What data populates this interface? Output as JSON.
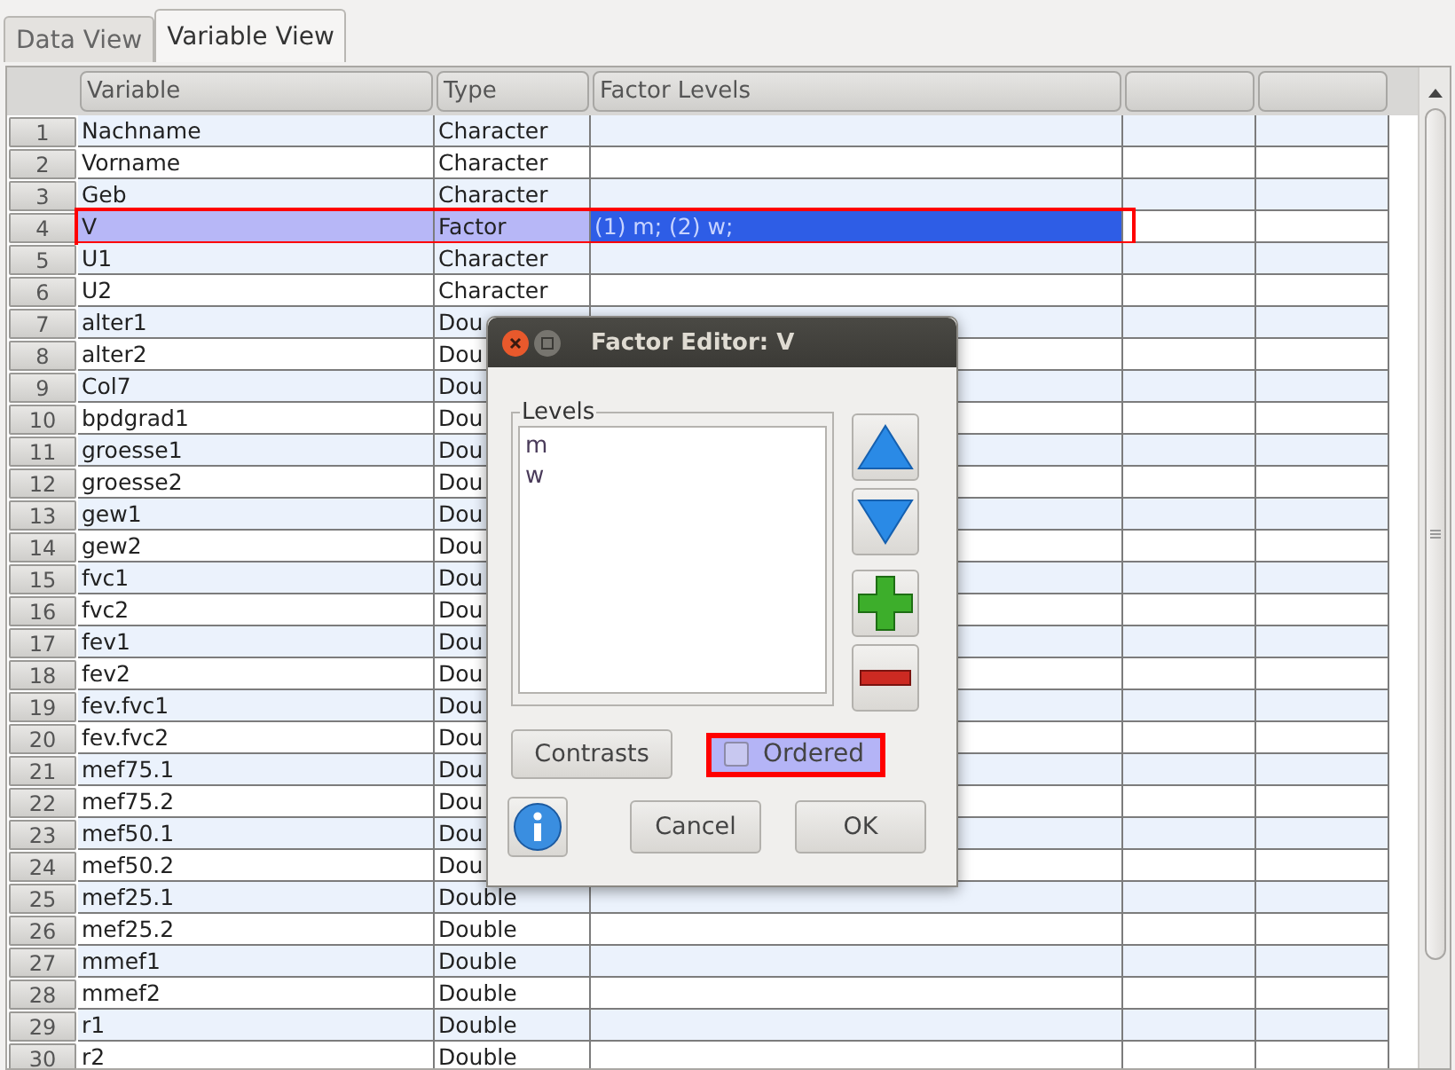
{
  "tabs": [
    {
      "label": "Data View",
      "selected": false
    },
    {
      "label": "Variable View",
      "selected": true
    }
  ],
  "table": {
    "columns": [
      {
        "kind": "text",
        "label": "Variable"
      },
      {
        "kind": "text",
        "label": "Type"
      },
      {
        "kind": "text",
        "label": "Factor Levels"
      },
      {
        "kind": "blank"
      },
      {
        "kind": "blank"
      }
    ],
    "rows": [
      {
        "num": "1",
        "variable": "Nachname",
        "type": "Character",
        "selected": false,
        "highlighted": false
      },
      {
        "num": "2",
        "variable": "Vorname",
        "type": "Character",
        "selected": false,
        "highlighted": false
      },
      {
        "num": "3",
        "variable": "Geb",
        "type": "Character",
        "selected": false,
        "highlighted": false
      },
      {
        "num": "4",
        "variable": "V",
        "type": "Factor",
        "factor_levels": "(1) m; (2) w;",
        "selected": true,
        "highlighted": true
      },
      {
        "num": "5",
        "variable": "U1",
        "type": "Character",
        "selected": false,
        "highlighted": false
      },
      {
        "num": "6",
        "variable": "U2",
        "type": "Character",
        "selected": false,
        "highlighted": false
      },
      {
        "num": "7",
        "variable": "alter1",
        "type": "Dou",
        "selected": false,
        "highlighted": false
      },
      {
        "num": "8",
        "variable": "alter2",
        "type": "Dou",
        "selected": false,
        "highlighted": false
      },
      {
        "num": "9",
        "variable": "Col7",
        "type": "Dou",
        "selected": false,
        "highlighted": false
      },
      {
        "num": "10",
        "variable": "bpdgrad1",
        "type": "Dou",
        "selected": false,
        "highlighted": false
      },
      {
        "num": "11",
        "variable": "groesse1",
        "type": "Dou",
        "selected": false,
        "highlighted": false
      },
      {
        "num": "12",
        "variable": "groesse2",
        "type": "Dou",
        "selected": false,
        "highlighted": false
      },
      {
        "num": "13",
        "variable": "gew1",
        "type": "Dou",
        "selected": false,
        "highlighted": false
      },
      {
        "num": "14",
        "variable": "gew2",
        "type": "Dou",
        "selected": false,
        "highlighted": false
      },
      {
        "num": "15",
        "variable": "fvc1",
        "type": "Dou",
        "selected": false,
        "highlighted": false
      },
      {
        "num": "16",
        "variable": "fvc2",
        "type": "Dou",
        "selected": false,
        "highlighted": false
      },
      {
        "num": "17",
        "variable": "fev1",
        "type": "Dou",
        "selected": false,
        "highlighted": false
      },
      {
        "num": "18",
        "variable": "fev2",
        "type": "Dou",
        "selected": false,
        "highlighted": false
      },
      {
        "num": "19",
        "variable": "fev.fvc1",
        "type": "Dou",
        "selected": false,
        "highlighted": false
      },
      {
        "num": "20",
        "variable": "fev.fvc2",
        "type": "Dou",
        "selected": false,
        "highlighted": false
      },
      {
        "num": "21",
        "variable": "mef75.1",
        "type": "Dou",
        "selected": false,
        "highlighted": false
      },
      {
        "num": "22",
        "variable": "mef75.2",
        "type": "Dou",
        "selected": false,
        "highlighted": false
      },
      {
        "num": "23",
        "variable": "mef50.1",
        "type": "Dou",
        "selected": false,
        "highlighted": false
      },
      {
        "num": "24",
        "variable": "mef50.2",
        "type": "Dou",
        "selected": false,
        "highlighted": false
      },
      {
        "num": "25",
        "variable": "mef25.1",
        "type": "Double",
        "selected": false,
        "highlighted": false
      },
      {
        "num": "26",
        "variable": "mef25.2",
        "type": "Double",
        "selected": false,
        "highlighted": false
      },
      {
        "num": "27",
        "variable": "mmef1",
        "type": "Double",
        "selected": false,
        "highlighted": false
      },
      {
        "num": "28",
        "variable": "mmef2",
        "type": "Double",
        "selected": false,
        "highlighted": false
      },
      {
        "num": "29",
        "variable": "r1",
        "type": "Double",
        "selected": false,
        "highlighted": false
      },
      {
        "num": "30",
        "variable": "r2",
        "type": "Double",
        "selected": false,
        "highlighted": false
      }
    ]
  },
  "dialog": {
    "title": "Factor Editor: V",
    "levels_label": "Levels",
    "levels": [
      "m",
      "w"
    ],
    "contrasts_button": "Contrasts",
    "ordered": {
      "label": "Ordered",
      "checked": false,
      "highlighted": true
    },
    "cancel_button": "Cancel",
    "ok_button": "OK"
  }
}
